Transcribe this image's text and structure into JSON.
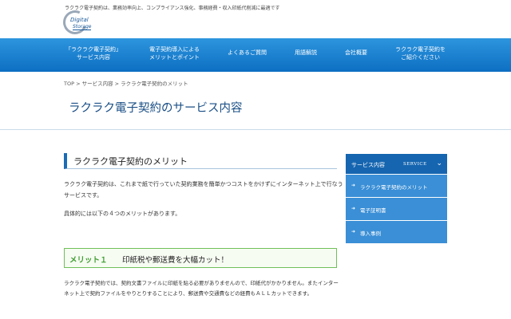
{
  "header": {
    "tagline": "ラクラク電子契約は、業務効率向上、コンプライアンス強化、事務経費・収入印紙代削減に最適です",
    "logo_line1": "Digital",
    "logo_line2": "Storage"
  },
  "nav": {
    "items": [
      {
        "line1": "「ラクラク電子契約」",
        "line2": "サービス内容"
      },
      {
        "line1": "電子契約導入による",
        "line2": "メリットとポイント"
      },
      {
        "line1": "よくあるご質問",
        "line2": ""
      },
      {
        "line1": "用語解説",
        "line2": ""
      },
      {
        "line1": "会社概要",
        "line2": ""
      },
      {
        "line1": "ラクラク電子契約を",
        "line2": "ご紹介ください"
      }
    ]
  },
  "breadcrumb": "TOP > サービス内容 > ラクラク電子契約のメリット",
  "page_title": "ラクラク電子契約のサービス内容",
  "main": {
    "section_heading": "ラクラク電子契約のメリット",
    "para1": "ラクラク電子契約は、これまで紙で行っていた契約業務を簡単かつコストをかけずにインターネット上で行なうサービスです。",
    "para2": "具体的には以下の４つのメリットがあります。",
    "merit1_label": "メリット１",
    "merit1_text": "印紙税や郵送費を大幅カット！",
    "para3": "ラクラク電子契約では、契約文書ファイルに印紙を貼る必要がありませんので、印紙代がかかりません。またインターネット上で契約ファイルをやりとりすることにより、郵送費や交通費などの経費もＡＬＬカットできます。"
  },
  "sidebar": {
    "heading": "サービス内容",
    "heading_en": "SERVICE",
    "items": [
      {
        "label": "ラクラク電子契約のメリット"
      },
      {
        "label": "電子証明書"
      },
      {
        "label": "導入事例"
      }
    ]
  },
  "colors": {
    "nav_blue": "#0d6fc2",
    "sidebar_head": "#1565b0",
    "sidebar_item": "#3a8fd6",
    "merit_green": "#3e9d2f",
    "title_blue": "#1a4f86"
  }
}
